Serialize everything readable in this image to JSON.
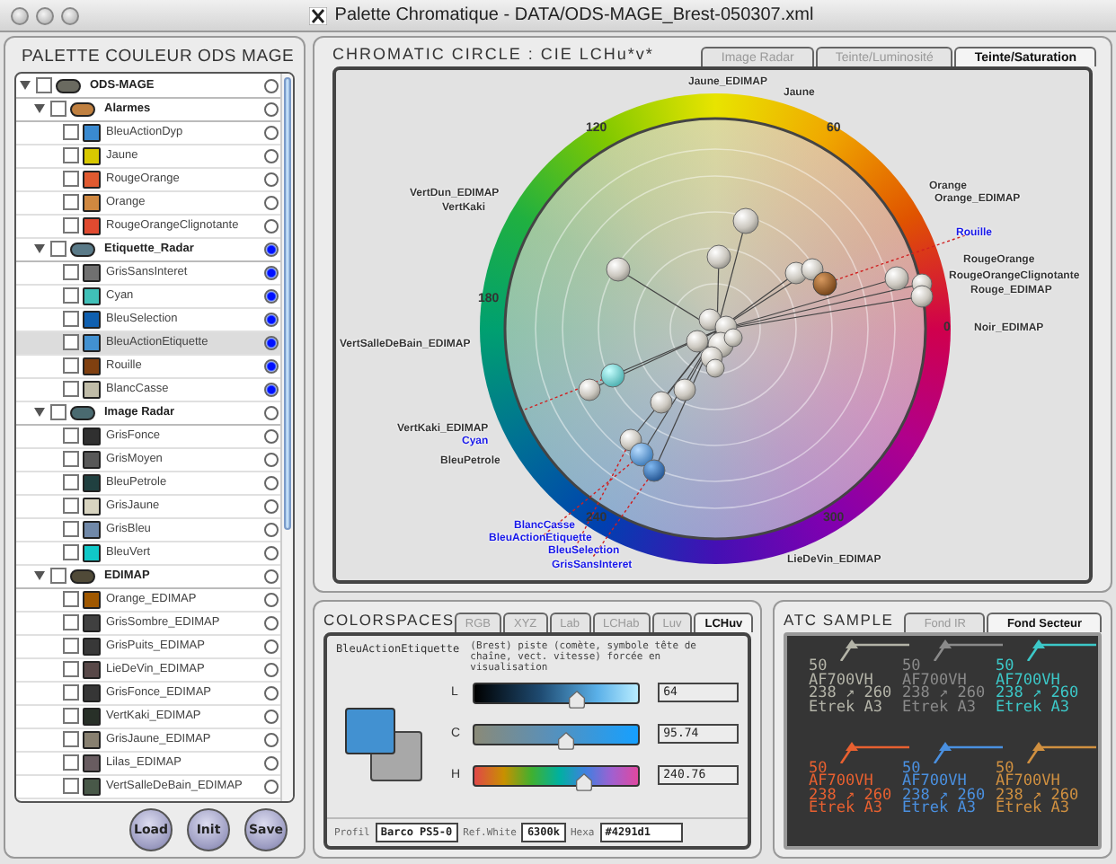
{
  "window": {
    "title": "Palette Chromatique - DATA/ODS-MAGE_Brest-050307.xml"
  },
  "palette": {
    "title": "PALETTE COULEUR ODS MAGE",
    "tree": [
      {
        "name": "ODS-MAGE",
        "color": "#6a6a60",
        "expanded": true,
        "checked": false,
        "radio": false,
        "highlighted": false,
        "children": [
          {
            "name": "Alarmes",
            "color": "#c08040",
            "expanded": true,
            "checked": false,
            "radio": false,
            "highlighted": false,
            "children": [
              {
                "name": "BleuActionDyp",
                "color": "#3a8ad0",
                "checked": false,
                "radio": false,
                "highlighted": false
              },
              {
                "name": "Jaune",
                "color": "#d8c800",
                "checked": false,
                "radio": false,
                "highlighted": false
              },
              {
                "name": "RougeOrange",
                "color": "#e05a30",
                "checked": false,
                "radio": false,
                "highlighted": false
              },
              {
                "name": "Orange",
                "color": "#d08840",
                "checked": false,
                "radio": false,
                "highlighted": false
              },
              {
                "name": "RougeOrangeClignotante",
                "color": "#e04a30",
                "checked": false,
                "radio": false,
                "highlighted": false
              }
            ]
          },
          {
            "name": "Etiquette_Radar",
            "color": "#5a7a88",
            "expanded": true,
            "checked": false,
            "radio": true,
            "highlighted": false,
            "children": [
              {
                "name": "GrisSansInteret",
                "color": "#707070",
                "checked": false,
                "radio": true,
                "highlighted": false
              },
              {
                "name": "Cyan",
                "color": "#40c0b8",
                "checked": false,
                "radio": true,
                "highlighted": false
              },
              {
                "name": "BleuSelection",
                "color": "#1060b0",
                "checked": false,
                "radio": true,
                "highlighted": false
              },
              {
                "name": "BleuActionEtiquette",
                "color": "#4291d1",
                "checked": false,
                "radio": true,
                "highlighted": true
              },
              {
                "name": "Rouille",
                "color": "#804010",
                "checked": false,
                "radio": true,
                "highlighted": false
              },
              {
                "name": "BlancCasse",
                "color": "#c0bca8",
                "checked": false,
                "radio": true,
                "highlighted": false
              }
            ]
          },
          {
            "name": "Image Radar",
            "color": "#4a6a70",
            "expanded": true,
            "checked": false,
            "radio": false,
            "highlighted": false,
            "children": [
              {
                "name": "GrisFonce",
                "color": "#303030",
                "checked": false,
                "radio": false,
                "highlighted": false
              },
              {
                "name": "GrisMoyen",
                "color": "#585858",
                "checked": false,
                "radio": false,
                "highlighted": false
              },
              {
                "name": "BleuPetrole",
                "color": "#204040",
                "checked": false,
                "radio": false,
                "highlighted": false
              },
              {
                "name": "GrisJaune",
                "color": "#d8d4c0",
                "checked": false,
                "radio": false,
                "highlighted": false
              },
              {
                "name": "GrisBleu",
                "color": "#7088a8",
                "checked": false,
                "radio": false,
                "highlighted": false
              },
              {
                "name": "BleuVert",
                "color": "#10c8c8",
                "checked": false,
                "radio": false,
                "highlighted": false
              }
            ]
          },
          {
            "name": "EDIMAP",
            "color": "#504a38",
            "expanded": true,
            "checked": false,
            "radio": false,
            "highlighted": false,
            "children": [
              {
                "name": "Orange_EDIMAP",
                "color": "#a05800",
                "checked": false,
                "radio": false,
                "highlighted": false
              },
              {
                "name": "GrisSombre_EDIMAP",
                "color": "#404040",
                "checked": false,
                "radio": false,
                "highlighted": false
              },
              {
                "name": "GrisPuits_EDIMAP",
                "color": "#383838",
                "checked": false,
                "radio": false,
                "highlighted": false
              },
              {
                "name": "LieDeVin_EDIMAP",
                "color": "#584848",
                "checked": false,
                "radio": false,
                "highlighted": false
              },
              {
                "name": "GrisFonce_EDIMAP",
                "color": "#363636",
                "checked": false,
                "radio": false,
                "highlighted": false
              },
              {
                "name": "VertKaki_EDIMAP",
                "color": "#283028",
                "checked": false,
                "radio": false,
                "highlighted": false
              },
              {
                "name": "GrisJaune_EDIMAP",
                "color": "#888070",
                "checked": false,
                "radio": false,
                "highlighted": false
              },
              {
                "name": "Lilas_EDIMAP",
                "color": "#685c60",
                "checked": false,
                "radio": false,
                "highlighted": false
              },
              {
                "name": "VertSalleDeBain_EDIMAP",
                "color": "#485848",
                "checked": false,
                "radio": false,
                "highlighted": false
              }
            ]
          }
        ]
      }
    ],
    "buttons": [
      "Load",
      "Init",
      "Save"
    ]
  },
  "chromatic_circle": {
    "title": "CHROMATIC CIRCLE : CIE LCHu*v*",
    "tabs": [
      {
        "label": "Image Radar",
        "selected": false
      },
      {
        "label": "Teinte/Luminosité",
        "selected": false
      },
      {
        "label": "Teinte/Saturation",
        "selected": true
      }
    ],
    "hue_ticks": [
      "0",
      "60",
      "120",
      "180",
      "240",
      "300"
    ],
    "labels": [
      {
        "text": "Jaune_EDIMAP",
        "highlighted": false
      },
      {
        "text": "Jaune",
        "highlighted": false
      },
      {
        "text": "Orange",
        "highlighted": false
      },
      {
        "text": "Orange_EDIMAP",
        "highlighted": false
      },
      {
        "text": "VertDun_EDIMAP",
        "highlighted": false
      },
      {
        "text": "VertKaki",
        "highlighted": false
      },
      {
        "text": "Rouille",
        "highlighted": true
      },
      {
        "text": "RougeOrange",
        "highlighted": false
      },
      {
        "text": "RougeOrangeClignotante",
        "highlighted": false
      },
      {
        "text": "Rouge_EDIMAP",
        "highlighted": false
      },
      {
        "text": "VertSalleDeBain_EDIMAP",
        "highlighted": false
      },
      {
        "text": "Noir_EDIMAP",
        "highlighted": false
      },
      {
        "text": "VertKaki_EDIMAP",
        "highlighted": false
      },
      {
        "text": "Cyan",
        "highlighted": true
      },
      {
        "text": "BleuPetrole",
        "highlighted": false
      },
      {
        "text": "BlancCasse",
        "highlighted": true
      },
      {
        "text": "BleuActionEtiquette",
        "highlighted": true
      },
      {
        "text": "BleuSelection",
        "highlighted": true
      },
      {
        "text": "GrisSansInteret",
        "highlighted": true
      },
      {
        "text": "LieDeVin_EDIMAP",
        "highlighted": false
      }
    ]
  },
  "colorspaces": {
    "title": "COLORSPACES",
    "tabs": [
      {
        "label": "RGB",
        "selected": false
      },
      {
        "label": "XYZ",
        "selected": false
      },
      {
        "label": "Lab",
        "selected": false
      },
      {
        "label": "LCHab",
        "selected": false
      },
      {
        "label": "Luv",
        "selected": false
      },
      {
        "label": "LCHuv",
        "selected": true
      }
    ],
    "color_name": "BleuActionEtiquette",
    "description": "(Brest) piste (comète, symbole tête de chaîne, vect. vitesse) forcée en visualisation",
    "channels": [
      {
        "kind": "lightness",
        "name": "L",
        "level": 0.63,
        "value": "64"
      },
      {
        "kind": "chroma",
        "name": "C",
        "level": 0.56,
        "value": "95.74"
      },
      {
        "kind": "hue",
        "name": "H",
        "level": 0.67,
        "value": "240.76"
      }
    ],
    "profile_label": "Profil",
    "profile": "Barco PS5-0",
    "ref_white_label": "Ref.White",
    "ref_white": "6300k",
    "hexa_label": "Hexa",
    "hex_value": "#4291d1"
  },
  "atc_sample": {
    "title": "ATC SAMPLE",
    "tabs": [
      {
        "label": "Fond IR",
        "selected": false
      },
      {
        "label": "Fond Secteur",
        "selected": true
      }
    ],
    "labels": [
      {
        "color": "#b4b4a8",
        "level": "50",
        "callsign": "AF700VH",
        "altitudes": "238 ↗ 260",
        "type": "Etrek A3"
      },
      {
        "color": "#8a8a8a",
        "level": "50",
        "callsign": "AF700VH",
        "altitudes": "238 ↗ 260",
        "type": "Etrek A3"
      },
      {
        "color": "#3cc8c8",
        "level": "50",
        "callsign": "AF700VH",
        "altitudes": "238 ↗ 260",
        "type": "Etrek A3"
      },
      {
        "color": "#e86030",
        "level": "50",
        "callsign": "AF700VH",
        "altitudes": "238 ↗ 260",
        "type": "Etrek A3"
      },
      {
        "color": "#4a90e0",
        "level": "50",
        "callsign": "AF700VH",
        "altitudes": "238 ↗ 260",
        "type": "Etrek A3"
      },
      {
        "color": "#d09040",
        "level": "50",
        "callsign": "AF700VH",
        "altitudes": "238 ↗ 260",
        "type": "Etrek A3"
      }
    ]
  }
}
